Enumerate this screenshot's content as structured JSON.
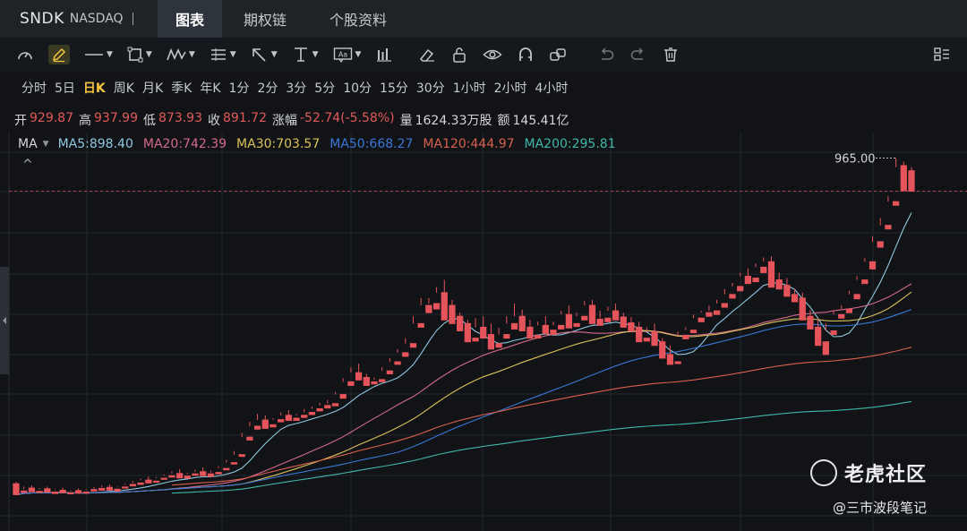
{
  "header": {
    "symbol": "SNDK",
    "exchange": "NASDAQ",
    "tabs": [
      {
        "label": "图表",
        "active": true
      },
      {
        "label": "期权链",
        "active": false
      },
      {
        "label": "个股资料",
        "active": false
      }
    ]
  },
  "toolbar": {
    "icons": [
      "gauge-icon",
      "pencil-icon",
      "line-icon",
      "rectangle-icon",
      "pattern-icon",
      "fib-icon",
      "arrow-icon",
      "text-cursor-icon",
      "annotation-icon",
      "bars-icon",
      "eraser-icon",
      "lock-icon",
      "eye-icon",
      "magnet-icon",
      "link-icon",
      "undo-icon",
      "redo-icon",
      "trash-icon",
      "layout-icon"
    ]
  },
  "periods": [
    {
      "label": "分时",
      "active": false
    },
    {
      "label": "5日",
      "active": false
    },
    {
      "label": "日K",
      "active": true
    },
    {
      "label": "周K",
      "active": false
    },
    {
      "label": "月K",
      "active": false
    },
    {
      "label": "季K",
      "active": false
    },
    {
      "label": "年K",
      "active": false
    },
    {
      "label": "1分",
      "active": false
    },
    {
      "label": "2分",
      "active": false
    },
    {
      "label": "3分",
      "active": false
    },
    {
      "label": "5分",
      "active": false
    },
    {
      "label": "10分",
      "active": false
    },
    {
      "label": "15分",
      "active": false
    },
    {
      "label": "30分",
      "active": false
    },
    {
      "label": "1小时",
      "active": false
    },
    {
      "label": "2小时",
      "active": false
    },
    {
      "label": "4小时",
      "active": false
    }
  ],
  "quote": {
    "open_label": "开",
    "open": "929.87",
    "high_label": "高",
    "high": "937.99",
    "low_label": "低",
    "low": "873.93",
    "close_label": "收",
    "close": "891.72",
    "change_label": "涨幅",
    "change": "-52.74(-5.58%)",
    "volume_label": "量",
    "volume": "1624.33万股",
    "amount_label": "额",
    "amount": "145.41亿"
  },
  "ma": {
    "label": "MA",
    "items": [
      {
        "text": "MA5:898.40",
        "color": "#8fc7e0"
      },
      {
        "text": "MA20:742.39",
        "color": "#d46a8a"
      },
      {
        "text": "MA30:703.57",
        "color": "#d9c25a"
      },
      {
        "text": "MA50:668.27",
        "color": "#3a78d8"
      },
      {
        "text": "MA120:444.97",
        "color": "#d9604e"
      },
      {
        "text": "MA200:295.81",
        "color": "#3fb8a8"
      }
    ]
  },
  "chart_data": {
    "type": "candlestick",
    "high_marker": "965.00",
    "ylim": [
      -60,
      1035
    ],
    "colors": {
      "up": "#2fb58a",
      "down": "#e5545a"
    },
    "candles": [
      [
        70,
        75,
        45,
        40
      ],
      [
        50,
        62,
        55,
        46
      ],
      [
        58,
        65,
        50,
        48
      ],
      [
        49,
        58,
        55,
        46
      ],
      [
        56,
        62,
        48,
        47
      ],
      [
        47,
        54,
        52,
        43
      ],
      [
        52,
        59,
        46,
        45
      ],
      [
        45,
        52,
        50,
        43
      ],
      [
        51,
        57,
        48,
        44
      ],
      [
        47,
        55,
        53,
        44
      ],
      [
        54,
        61,
        56,
        50
      ],
      [
        57,
        65,
        60,
        52
      ],
      [
        60,
        68,
        54,
        52
      ],
      [
        55,
        62,
        60,
        50
      ],
      [
        61,
        70,
        67,
        58
      ],
      [
        68,
        78,
        72,
        64
      ],
      [
        72,
        84,
        80,
        68
      ],
      [
        80,
        90,
        76,
        72
      ],
      [
        77,
        88,
        85,
        74
      ],
      [
        85,
        95,
        92,
        82
      ],
      [
        92,
        104,
        98,
        88
      ],
      [
        98,
        110,
        90,
        86
      ],
      [
        91,
        100,
        97,
        85
      ],
      [
        97,
        108,
        103,
        93
      ],
      [
        103,
        115,
        96,
        92
      ],
      [
        97,
        106,
        101,
        90
      ],
      [
        101,
        118,
        113,
        97
      ],
      [
        112,
        135,
        128,
        108
      ],
      [
        128,
        160,
        150,
        124
      ],
      [
        150,
        210,
        198,
        145
      ],
      [
        198,
        240,
        228,
        190
      ],
      [
        228,
        262,
        245,
        220
      ],
      [
        245,
        258,
        232,
        222
      ],
      [
        232,
        250,
        246,
        226
      ],
      [
        246,
        266,
        258,
        240
      ],
      [
        258,
        272,
        250,
        244
      ],
      [
        250,
        262,
        258,
        244
      ],
      [
        258,
        275,
        266,
        252
      ],
      [
        266,
        282,
        276,
        260
      ],
      [
        276,
        292,
        285,
        270
      ],
      [
        285,
        300,
        290,
        278
      ],
      [
        290,
        322,
        315,
        284
      ],
      [
        315,
        360,
        350,
        305
      ],
      [
        350,
        390,
        375,
        340
      ],
      [
        375,
        400,
        362,
        355
      ],
      [
        362,
        372,
        350,
        340
      ],
      [
        350,
        362,
        356,
        344
      ],
      [
        356,
        390,
        380,
        350
      ],
      [
        380,
        415,
        405,
        372
      ],
      [
        405,
        440,
        430,
        398
      ],
      [
        430,
        470,
        455,
        420
      ],
      [
        455,
        530,
        510,
        445
      ],
      [
        510,
        580,
        560,
        500
      ],
      [
        560,
        580,
        565,
        540
      ],
      [
        565,
        610,
        595,
        550
      ],
      [
        595,
        630,
        560,
        520
      ],
      [
        560,
        575,
        530,
        510
      ],
      [
        530,
        540,
        510,
        490
      ],
      [
        510,
        520,
        470,
        460
      ],
      [
        470,
        525,
        500,
        462
      ],
      [
        500,
        530,
        480,
        470
      ],
      [
        480,
        510,
        455,
        440
      ],
      [
        455,
        498,
        480,
        445
      ],
      [
        480,
        530,
        510,
        470
      ],
      [
        510,
        565,
        530,
        495
      ],
      [
        530,
        548,
        500,
        490
      ],
      [
        500,
        520,
        478,
        470
      ],
      [
        478,
        515,
        505,
        470
      ],
      [
        505,
        530,
        492,
        482
      ],
      [
        492,
        515,
        505,
        480
      ],
      [
        505,
        545,
        535,
        495
      ],
      [
        535,
        560,
        510,
        498
      ],
      [
        510,
        540,
        530,
        502
      ],
      [
        530,
        572,
        560,
        520
      ],
      [
        560,
        575,
        522,
        510
      ],
      [
        522,
        545,
        525,
        505
      ],
      [
        525,
        556,
        545,
        515
      ],
      [
        545,
        565,
        528,
        520
      ],
      [
        528,
        540,
        512,
        500
      ],
      [
        512,
        528,
        500,
        490
      ],
      [
        500,
        515,
        470,
        460
      ],
      [
        470,
        500,
        488,
        462
      ],
      [
        488,
        510,
        460,
        450
      ],
      [
        460,
        470,
        425,
        415
      ],
      [
        425,
        450,
        405,
        398
      ],
      [
        405,
        488,
        478,
        400
      ],
      [
        478,
        500,
        492,
        468
      ],
      [
        492,
        535,
        525,
        485
      ],
      [
        525,
        545,
        540,
        515
      ],
      [
        540,
        560,
        545,
        530
      ],
      [
        545,
        575,
        565,
        535
      ],
      [
        565,
        605,
        590,
        555
      ],
      [
        590,
        622,
        612,
        580
      ],
      [
        612,
        650,
        640,
        600
      ],
      [
        640,
        662,
        635,
        620
      ],
      [
        635,
        675,
        665,
        625
      ],
      [
        665,
        692,
        680,
        650
      ],
      [
        680,
        695,
        630,
        610
      ],
      [
        630,
        650,
        615,
        605
      ],
      [
        615,
        635,
        590,
        585
      ],
      [
        590,
        605,
        580,
        570
      ],
      [
        580,
        595,
        530,
        520
      ],
      [
        530,
        548,
        500,
        495
      ],
      [
        500,
        525,
        460,
        450
      ],
      [
        460,
        510,
        490,
        425
      ],
      [
        490,
        545,
        535,
        480
      ],
      [
        535,
        560,
        550,
        525
      ],
      [
        550,
        600,
        590,
        540
      ],
      [
        590,
        640,
        630,
        578
      ],
      [
        630,
        690,
        680,
        620
      ],
      [
        680,
        750,
        735,
        660
      ],
      [
        735,
        800,
        780,
        720
      ],
      [
        780,
        860,
        845,
        770
      ],
      [
        845,
        965,
        940,
        835
      ],
      [
        944,
        955,
        890,
        875
      ],
      [
        930,
        940,
        892,
        874
      ]
    ]
  }
}
